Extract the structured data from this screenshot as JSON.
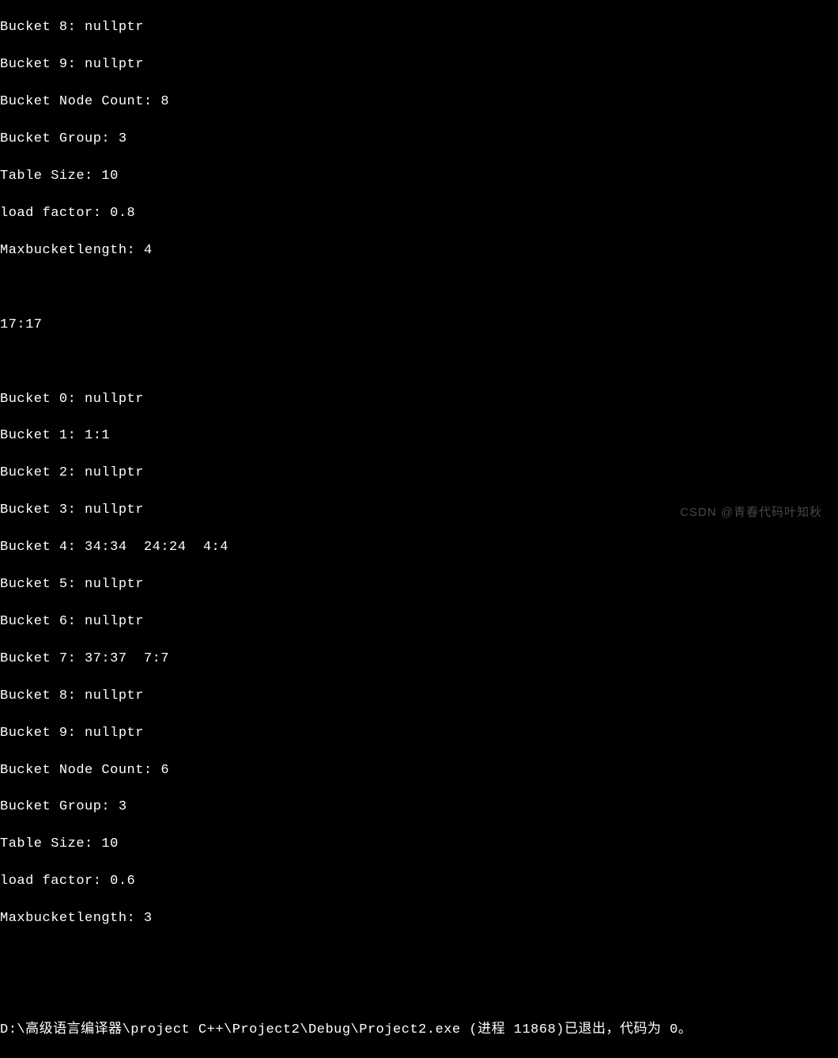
{
  "output": {
    "section1": {
      "bucket8": "Bucket 8: nullptr",
      "bucket9": "Bucket 9: nullptr",
      "nodeCount": "Bucket Node Count: 8",
      "group": "Bucket Group: 3",
      "tableSize": "Table Size: 10",
      "loadFactor": "load factor: 0.8",
      "maxLength": "Maxbucketlength: 4"
    },
    "divider": "17:17",
    "section2": {
      "bucket0": "Bucket 0: nullptr",
      "bucket1": "Bucket 1: 1:1",
      "bucket2": "Bucket 2: nullptr",
      "bucket3": "Bucket 3: nullptr",
      "bucket4": "Bucket 4: 34:34  24:24  4:4",
      "bucket5": "Bucket 5: nullptr",
      "bucket6": "Bucket 6: nullptr",
      "bucket7": "Bucket 7: 37:37  7:7",
      "bucket8": "Bucket 8: nullptr",
      "bucket9": "Bucket 9: nullptr",
      "nodeCount": "Bucket Node Count: 6",
      "group": "Bucket Group: 3",
      "tableSize": "Table Size: 10",
      "loadFactor": "load factor: 0.6",
      "maxLength": "Maxbucketlength: 3"
    },
    "footer": "D:\\高级语言编译器\\project C++\\Project2\\Debug\\Project2.exe (进程 11868)已退出，代码为 0。",
    "watermark": "CSDN @青春代码叶知秋"
  }
}
